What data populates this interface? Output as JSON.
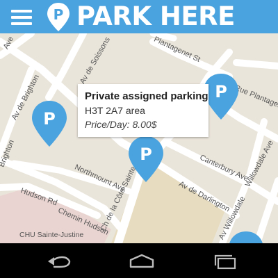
{
  "app_bar": {
    "title": "PARK HERE",
    "background_color": "#4aa3df",
    "menu_icon": "hamburger-menu-icon",
    "logo_icon": "parking-pin-logo-icon"
  },
  "map": {
    "street_labels": [
      "Av de Soissons",
      "Av de Brighton",
      "Brighton",
      "Plantagenet St",
      "Rue Plantagenet",
      "Canterbury Ave",
      "Willowdale Ave",
      "Northmount Ave",
      "Ch de la Côte-Sainte-Catherine",
      "Av de Darlington",
      "Av Willowdale",
      "Hudson Rd",
      "Chemin Hudson",
      "CHU Sainte-Justine",
      "Ave",
      "ngton",
      "Ave"
    ],
    "marker_color": "#4aa3df",
    "marker_letter": "P"
  },
  "info_window": {
    "title": "Private assigned parking",
    "area": "H3T 2A7 area",
    "price": "Price/Day: 8.00$"
  },
  "nav_bar": {
    "back_icon": "back-icon",
    "home_icon": "home-icon",
    "recents_icon": "recent-apps-icon"
  }
}
